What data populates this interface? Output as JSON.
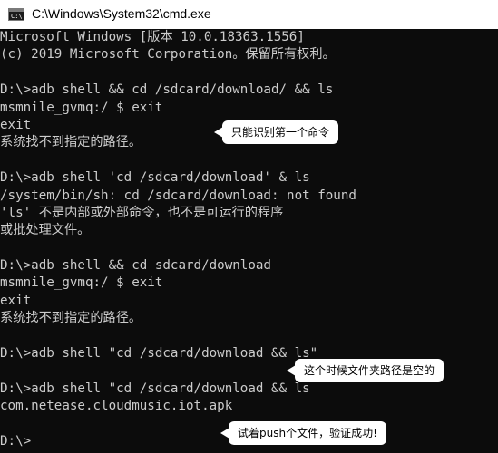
{
  "window": {
    "title": "C:\\Windows\\System32\\cmd.exe",
    "icon_text": "C:\\."
  },
  "console": {
    "lines": [
      "Microsoft Windows [版本 10.0.18363.1556]",
      "(c) 2019 Microsoft Corporation。保留所有权利。",
      "",
      "D:\\>adb shell && cd /sdcard/download/ && ls",
      "msmnile_gvmq:/ $ exit",
      "exit",
      "系统找不到指定的路径。",
      "",
      "D:\\>adb shell 'cd /sdcard/download' & ls",
      "/system/bin/sh: cd /sdcard/download: not found",
      "'ls' 不是内部或外部命令，也不是可运行的程序",
      "或批处理文件。",
      "",
      "D:\\>adb shell && cd sdcard/download",
      "msmnile_gvmq:/ $ exit",
      "exit",
      "系统找不到指定的路径。",
      "",
      "D:\\>adb shell \"cd /sdcard/download && ls\"",
      "",
      "D:\\>adb shell \"cd /sdcard/download && ls",
      "com.netease.cloudmusic.iot.apk",
      "",
      "D:\\>"
    ]
  },
  "callouts": {
    "c1": "只能识别第一个命令",
    "c2": "这个时候文件夹路径是空的",
    "c3": "试着push个文件，验证成功!"
  }
}
